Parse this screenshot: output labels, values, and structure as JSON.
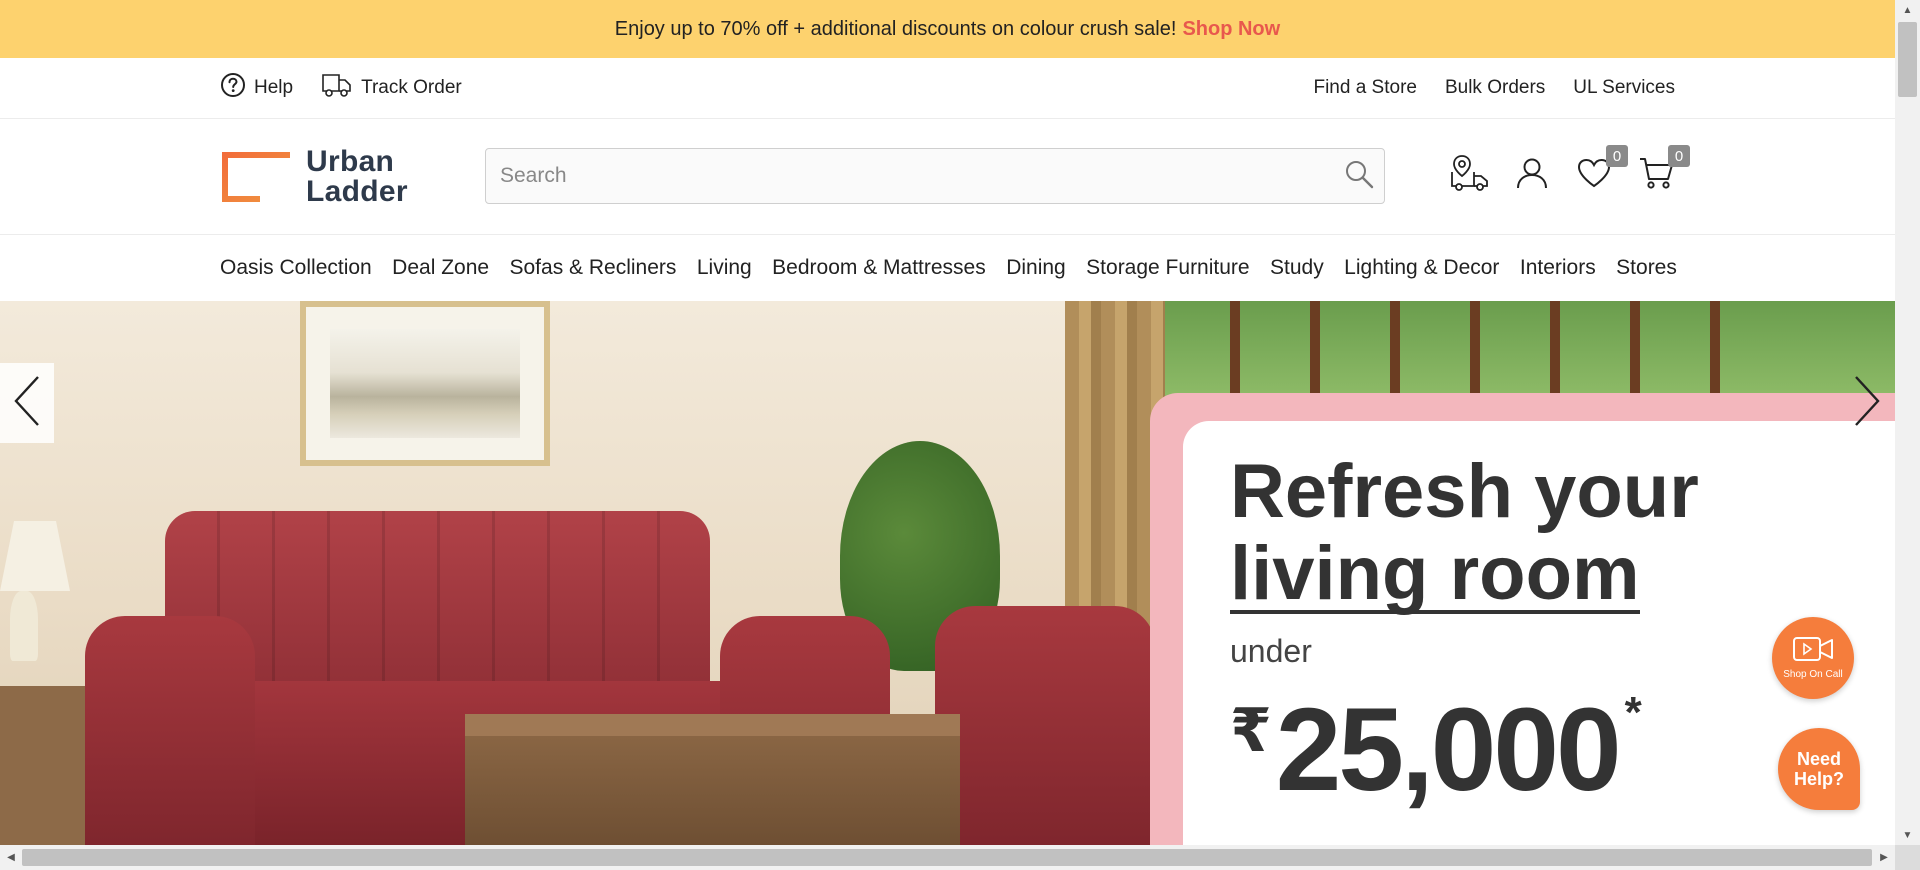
{
  "promo_bar": {
    "text": "Enjoy up to 70% off + additional discounts on colour crush sale!",
    "link": "Shop Now",
    "background": "#fdd26e",
    "link_color": "#e8584d"
  },
  "utility_bar": {
    "left": [
      {
        "label": "Help",
        "icon": "help-circle-icon"
      },
      {
        "label": "Track Order",
        "icon": "delivery-truck-icon"
      }
    ],
    "right": [
      {
        "label": "Find a Store"
      },
      {
        "label": "Bulk Orders"
      },
      {
        "label": "UL Services"
      }
    ]
  },
  "header": {
    "logo": {
      "line1": "Urban",
      "line2": "Ladder"
    },
    "search": {
      "placeholder": "Search",
      "value": ""
    },
    "icons": {
      "store_delivery": "location-truck-icon",
      "account": "user-icon",
      "wishlist": {
        "icon": "heart-icon",
        "count": "0"
      },
      "cart": {
        "icon": "cart-icon",
        "count": "0"
      }
    }
  },
  "nav": {
    "items": [
      "Oasis Collection",
      "Deal Zone",
      "Sofas & Recliners",
      "Living",
      "Bedroom & Mattresses",
      "Dining",
      "Storage Furniture",
      "Study",
      "Lighting & Decor",
      "Interiors",
      "Stores"
    ]
  },
  "hero": {
    "title_line1": "Refresh your",
    "title_line2": "living room",
    "under": "under",
    "currency": "₹",
    "price": "25,000",
    "asterisk": "*",
    "card_border_color": "#f3b7bd"
  },
  "floating": {
    "shop_on_call": "Shop On Call",
    "need_help": "Need Help?",
    "accent": "#f57d3c"
  }
}
